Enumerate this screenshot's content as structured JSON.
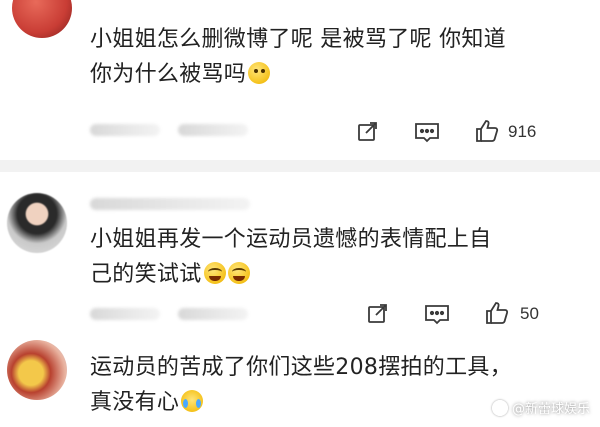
{
  "comments": [
    {
      "text_line1": "小姐姐怎么删微博了呢 是被骂了呢 你知道",
      "text_line2": "你为什么被骂吗",
      "emoji": "thinking-emoji",
      "likes": "916"
    },
    {
      "text_line1": "小姐姐再发一个运动员遗憾的表情配上自",
      "text_line2": "己的笑试试",
      "emoji": "laughing-tears-emoji",
      "likes": "50"
    },
    {
      "text_line1": "运动员的苦成了你们这些208摆拍的工具，",
      "text_line2": "真没有心",
      "emoji": "crying-emoji"
    }
  ],
  "watermark": "@新蕾球娱乐",
  "icons": {
    "share": "share-icon",
    "comment": "comment-icon",
    "like": "thumbs-up-icon"
  },
  "colors": {
    "divider": "#f2f2f2",
    "icon": "#3a3a3a",
    "text": "#222222"
  }
}
